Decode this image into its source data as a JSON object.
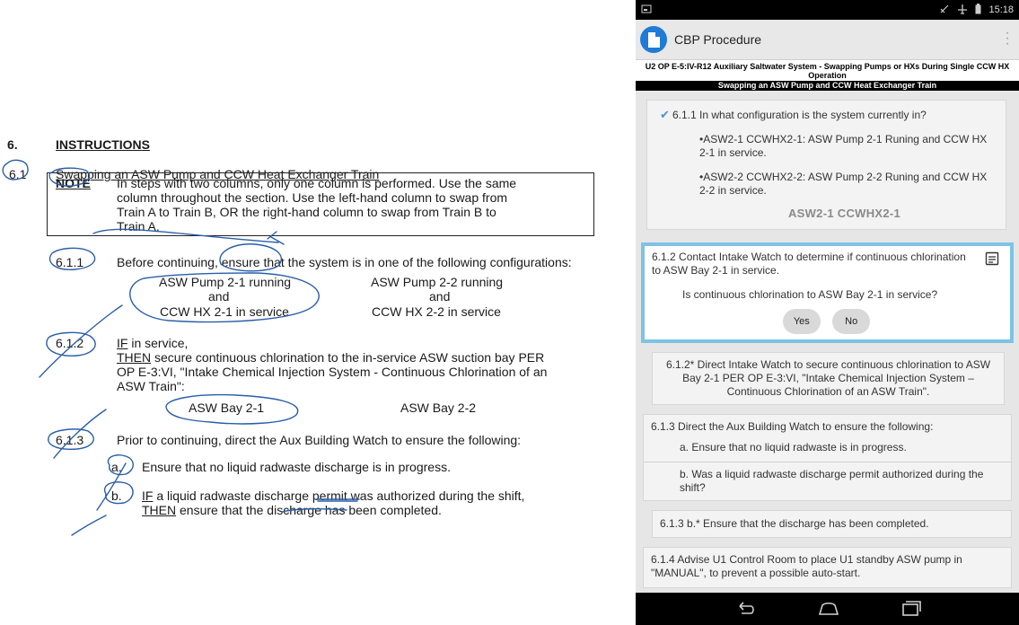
{
  "paper": {
    "section_num": "6.",
    "section_title": "INSTRUCTIONS",
    "sub_num": "6.1",
    "sub_title": "Swapping an ASW Pump and CCW Heat Exchanger Train",
    "note_label": "NOTE",
    "note_lines": [
      "In steps with two columns, only one column is performed. Use the same",
      "column throughout the section. Use the left-hand column to swap from",
      "Train A to Train B, OR the right-hand column to swap from Train B to",
      "Train A."
    ],
    "s611_num": "6.1.1",
    "s611_text": "Before continuing, ensure that the system is in one of the following configurations:",
    "cfg_left": [
      "ASW Pump 2-1 running",
      "and",
      "CCW HX 2-1 in service"
    ],
    "cfg_right": [
      "ASW Pump 2-2 running",
      "and",
      "CCW HX 2-2 in service"
    ],
    "s612_num": "6.1.2",
    "s612_if": "IF",
    "s612_if_rest": " in service,",
    "s612_then": "THEN",
    "s612_then_rest": " secure continuous chlorination to the in-service ASW suction bay PER",
    "s612_line3": "OP E-3:VI, \"Intake Chemical Injection System - Continuous Chlorination of an",
    "s612_line4": "ASW Train\":",
    "bay_left": "ASW Bay 2-1",
    "bay_right": "ASW Bay 2-2",
    "s613_num": "6.1.3",
    "s613_text": "Prior to continuing, direct the Aux Building Watch to ensure the following:",
    "s613a_num": "a.",
    "s613a_text": "Ensure that no liquid radwaste discharge is in progress.",
    "s613b_num": "b.",
    "s613b_if": "IF",
    "s613b_line1_rest": " a liquid radwaste discharge permit was authorized during the shift,",
    "s613b_then": "THEN",
    "s613b_line2_rest": " ensure that the discharge has been completed."
  },
  "tablet": {
    "status_time": "15:18",
    "app_title": "CBP Procedure",
    "doc_title_line1": "U2 OP E-5:IV-R12 Auxiliary Saltwater System - Swapping Pumps or HXs During Single CCW HX",
    "doc_title_line2": "Operation",
    "section_bar": "Swapping an ASW Pump and CCW Heat Exchanger Train",
    "step611_question": "6.1.1 In what configuration is the system currently in?",
    "step611_opt1": "•ASW2-1 CCWHX2-1: ASW Pump 2-1 Runing and CCW HX 2-1 in service.",
    "step611_opt2": "•ASW2-2 CCWHX2-2: ASW Pump 2-2 Runing and CCW HX 2-2 in service.",
    "step611_answer": "ASW2-1 CCWHX2-1",
    "step612_text": "6.1.2 Contact Intake Watch to determine if continuous chlorination to ASW Bay 2-1 in service.",
    "step612_question": "Is continuous chlorination to ASW Bay 2-1 in service?",
    "yes_label": "Yes",
    "no_label": "No",
    "step612b_text": "6.1.2* Direct Intake Watch to secure continuous chlorination to ASW Bay 2-1 PER OP E-3:VI, \"Intake Chemical Injection System – Continuous Chlorination of an ASW Train\".",
    "step613_text": "6.1.3 Direct the Aux Building Watch to ensure the following:",
    "step613a_text": "a. Ensure that no liquid radwaste is in progress.",
    "step613b_text": "b. Was a liquid radwaste discharge permit authorized during the shift?",
    "step613b2_text": "6.1.3 b.* Ensure that the discharge has been completed.",
    "step614_text": "6.1.4 Advise U1 Control Room to place U1 standby ASW pump in \"MANUAL\", to prevent a possible auto-start."
  },
  "colors": {
    "accent_blue": "#1f7bd6",
    "active_border": "#7dc3e6",
    "check_blue": "#4a8fd8",
    "ink_blue": "#2a5ea8"
  }
}
